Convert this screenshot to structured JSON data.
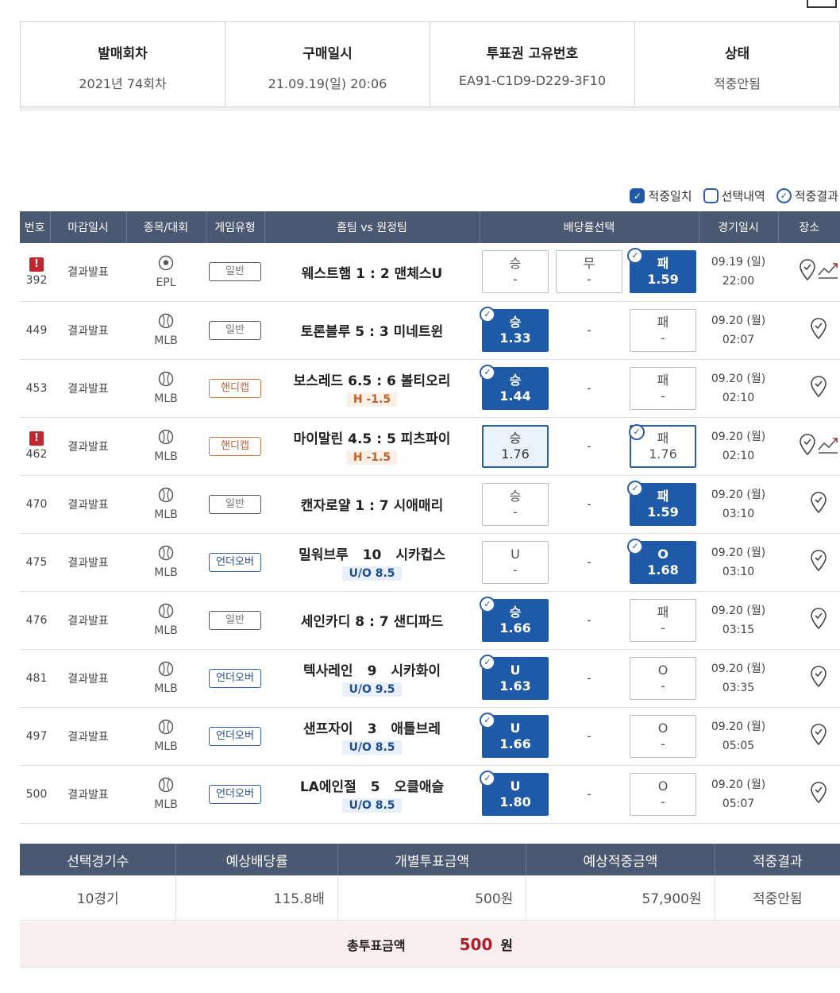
{
  "summary": [
    {
      "label": "발매회차",
      "value": "2021년 74회차"
    },
    {
      "label": "구매일시",
      "value": "21.09.19(일) 20:06"
    },
    {
      "label": "투표권 고유번호",
      "value": "EA91-C1D9-D229-3F10"
    },
    {
      "label": "상태",
      "value": "적중안됨"
    }
  ],
  "legend": {
    "hit_match": "적중일치",
    "selection": "선택내역",
    "hit_result": "적중결과"
  },
  "table_headers": [
    "번호",
    "마감일시",
    "종목/대회",
    "게임유형",
    "홈팀 vs 원정팀",
    "배당률선택",
    "경기일시",
    "장소"
  ],
  "games": [
    {
      "no": "392",
      "warn": "!",
      "deadline": "결과발표",
      "league": "EPL",
      "type": "일반",
      "home": "웨스트햄 1",
      "away": "2 맨체스U",
      "sub": "",
      "odds": [
        {
          "label": "승",
          "value": "-"
        },
        {
          "label": "무",
          "value": "-"
        },
        {
          "label": "패",
          "value": "1.59"
        }
      ],
      "date": "09.19 (일)",
      "time": "22:00"
    },
    {
      "no": "449",
      "warn": "",
      "deadline": "결과발표",
      "league": "MLB",
      "type": "일반",
      "home": "토론블루 5",
      "away": "3 미네트윈",
      "sub": "",
      "odds": [
        {
          "label": "승",
          "value": "1.33"
        },
        {
          "label": "",
          "value": "-"
        },
        {
          "label": "패",
          "value": "-"
        }
      ],
      "date": "09.20 (월)",
      "time": "02:07"
    },
    {
      "no": "453",
      "warn": "",
      "deadline": "결과발표",
      "league": "MLB",
      "type": "핸디캡",
      "home": "보스레드 6.5",
      "away": "6 볼티오리",
      "sub": "H -1.5",
      "odds": [
        {
          "label": "승",
          "value": "1.44"
        },
        {
          "label": "",
          "value": "-"
        },
        {
          "label": "패",
          "value": "-"
        }
      ],
      "date": "09.20 (월)",
      "time": "02:10"
    },
    {
      "no": "462",
      "warn": "!",
      "deadline": "결과발표",
      "league": "MLB",
      "type": "핸디캡",
      "home": "마이말린 4.5",
      "away": "5 피츠파이",
      "sub": "H -1.5",
      "odds": [
        {
          "label": "승",
          "value": "1.76"
        },
        {
          "label": "",
          "value": "-"
        },
        {
          "label": "패",
          "value": "1.76"
        }
      ],
      "date": "09.20 (월)",
      "time": "02:10"
    },
    {
      "no": "470",
      "warn": "",
      "deadline": "결과발표",
      "league": "MLB",
      "type": "일반",
      "home": "캔자로얄 1",
      "away": "7 시애매리",
      "sub": "",
      "odds": [
        {
          "label": "승",
          "value": "-"
        },
        {
          "label": "",
          "value": "-"
        },
        {
          "label": "패",
          "value": "1.59"
        }
      ],
      "date": "09.20 (월)",
      "time": "03:10"
    },
    {
      "no": "475",
      "warn": "",
      "deadline": "결과발표",
      "league": "MLB",
      "type": "언더오버",
      "home": "밀워브루",
      "score": "10",
      "away": "시카컵스",
      "sub": "U/O 8.5",
      "odds": [
        {
          "label": "U",
          "value": "-"
        },
        {
          "label": "",
          "value": "-"
        },
        {
          "label": "O",
          "value": "1.68"
        }
      ],
      "date": "09.20 (월)",
      "time": "03:10"
    },
    {
      "no": "476",
      "warn": "",
      "deadline": "결과발표",
      "league": "MLB",
      "type": "일반",
      "home": "세인카디 8",
      "away": "7 샌디파드",
      "sub": "",
      "odds": [
        {
          "label": "승",
          "value": "1.66"
        },
        {
          "label": "",
          "value": "-"
        },
        {
          "label": "패",
          "value": "-"
        }
      ],
      "date": "09.20 (월)",
      "time": "03:15"
    },
    {
      "no": "481",
      "warn": "",
      "deadline": "결과발표",
      "league": "MLB",
      "type": "언더오버",
      "home": "텍사레인",
      "score": "9",
      "away": "시카화이",
      "sub": "U/O 9.5",
      "odds": [
        {
          "label": "U",
          "value": "1.63"
        },
        {
          "label": "",
          "value": "-"
        },
        {
          "label": "O",
          "value": "-"
        }
      ],
      "date": "09.20 (월)",
      "time": "03:35"
    },
    {
      "no": "497",
      "warn": "",
      "deadline": "결과발표",
      "league": "MLB",
      "type": "언더오버",
      "home": "샌프자이",
      "score": "3",
      "away": "애틀브레",
      "sub": "U/O 8.5",
      "odds": [
        {
          "label": "U",
          "value": "1.66"
        },
        {
          "label": "",
          "value": "-"
        },
        {
          "label": "O",
          "value": "-"
        }
      ],
      "date": "09.20 (월)",
      "time": "05:05"
    },
    {
      "no": "500",
      "warn": "",
      "deadline": "결과발표",
      "league": "MLB",
      "type": "언더오버",
      "home": "LA에인절",
      "score": "5",
      "away": "오클애슬",
      "sub": "U/O 8.5",
      "odds": [
        {
          "label": "U",
          "value": "1.80"
        },
        {
          "label": "",
          "value": "-"
        },
        {
          "label": "O",
          "value": "-"
        }
      ],
      "date": "09.20 (월)",
      "time": "05:07"
    }
  ],
  "totals": {
    "headers": [
      "선택경기수",
      "예상배당률",
      "개별투표금액",
      "예상적중금액",
      "적중결과"
    ],
    "values": [
      "10경기",
      "115.8배",
      "500원",
      "57,900원",
      "적중안됨"
    ],
    "grand_label": "총투표금액",
    "grand_value": "500",
    "grand_unit": "원"
  },
  "colors": {
    "header_bg": "#4a5872",
    "hit_blue": "#1f5aa8",
    "warn_red": "#c0262d",
    "total_red": "#b01e2e"
  }
}
